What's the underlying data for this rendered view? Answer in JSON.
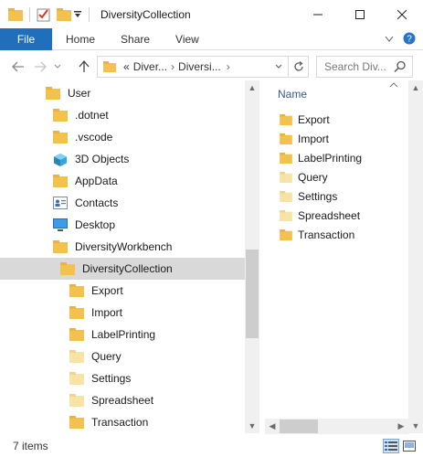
{
  "window": {
    "title": "DiversityCollection",
    "controls": [
      "minimize",
      "maximize",
      "close"
    ]
  },
  "ribbon": {
    "tabs": [
      "File",
      "Home",
      "Share",
      "View"
    ],
    "active_tab": "File",
    "accent": "#1f6fbd"
  },
  "nav": {
    "path_prefix": "«",
    "path_segments": [
      "Diver...",
      "Diversi..."
    ],
    "search_placeholder": "Search Div..."
  },
  "tree": {
    "items": [
      {
        "label": "User",
        "icon": "folder-icon",
        "level": 0
      },
      {
        "label": ".dotnet",
        "icon": "folder-icon",
        "level": 1
      },
      {
        "label": ".vscode",
        "icon": "folder-icon",
        "level": 1
      },
      {
        "label": "3D Objects",
        "icon": "3d-objects-icon",
        "level": 1
      },
      {
        "label": "AppData",
        "icon": "folder-icon",
        "level": 1
      },
      {
        "label": "Contacts",
        "icon": "contacts-icon",
        "level": 1
      },
      {
        "label": "Desktop",
        "icon": "desktop-icon",
        "level": 1
      },
      {
        "label": "DiversityWorkbench",
        "icon": "folder-icon",
        "level": 1
      },
      {
        "label": "DiversityCollection",
        "icon": "folder-icon",
        "level": 2,
        "selected": true
      },
      {
        "label": "Export",
        "icon": "folder-icon",
        "level": 3
      },
      {
        "label": "Import",
        "icon": "folder-icon",
        "level": 3
      },
      {
        "label": "LabelPrinting",
        "icon": "folder-icon",
        "level": 3
      },
      {
        "label": "Query",
        "icon": "folder-light-icon",
        "level": 3
      },
      {
        "label": "Settings",
        "icon": "folder-light-icon",
        "level": 3
      },
      {
        "label": "Spreadsheet",
        "icon": "folder-light-icon",
        "level": 3
      },
      {
        "label": "Transaction",
        "icon": "folder-icon",
        "level": 3
      }
    ]
  },
  "content": {
    "column_header": "Name",
    "files": [
      {
        "label": "Export",
        "icon": "folder-icon"
      },
      {
        "label": "Import",
        "icon": "folder-icon"
      },
      {
        "label": "LabelPrinting",
        "icon": "folder-icon"
      },
      {
        "label": "Query",
        "icon": "folder-light-icon"
      },
      {
        "label": "Settings",
        "icon": "folder-light-icon"
      },
      {
        "label": "Spreadsheet",
        "icon": "folder-light-icon"
      },
      {
        "label": "Transaction",
        "icon": "folder-icon"
      }
    ]
  },
  "status": {
    "item_count": "7 items"
  }
}
